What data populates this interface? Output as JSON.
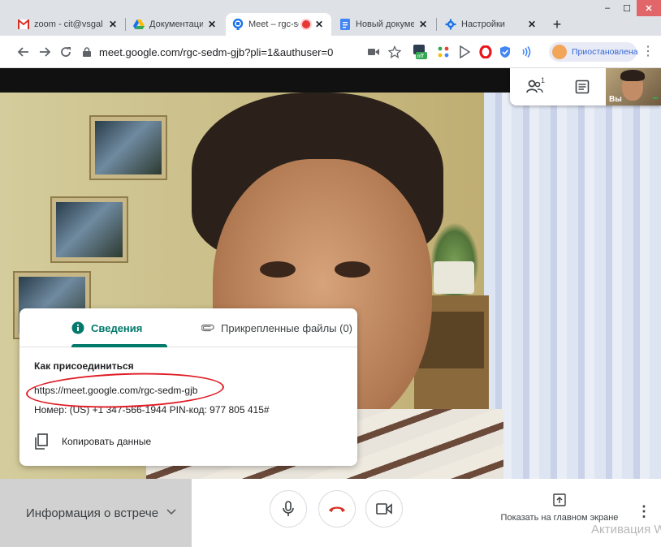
{
  "browser": {
    "tabs": [
      {
        "label": "zoom - cit@vsgal",
        "icon": "gmail-icon",
        "close": "✕"
      },
      {
        "label": "Документация -",
        "icon": "google-drive-icon",
        "close": "✕"
      },
      {
        "label": "Meet – rgc-se",
        "icon": "meet-icon",
        "close": "✕",
        "active": true
      },
      {
        "label": "Новый документ",
        "icon": "docs-icon",
        "close": "✕"
      },
      {
        "label": "Настройки",
        "icon": "settings-gear-icon",
        "close": "✕"
      }
    ],
    "new_tab": "+",
    "window": {
      "minimize": "–",
      "maximize": "☐",
      "close": "✕"
    },
    "url": "meet.google.com/rgc-sedm-gjb?pli=1&authuser=0",
    "profile_status": "Приостановлена",
    "ext_off_badge": "off"
  },
  "meet": {
    "participants_count": "1",
    "self_label": "Вы",
    "info_card": {
      "tab_details": "Сведения",
      "tab_attachments": "Прикрепленные файлы (0)",
      "join_heading": "Как присоединиться",
      "join_link": "https://meet.google.com/rgc-sedm-gjb",
      "phone": "Номер: (US) +1 347-566-1944 PIN-код: 977 805 415#",
      "copy_label": "Копировать данные"
    },
    "bottom": {
      "meeting_info": "Информация о встрече",
      "present_label": "Показать на главном экране"
    },
    "watermark": "Активация W"
  }
}
